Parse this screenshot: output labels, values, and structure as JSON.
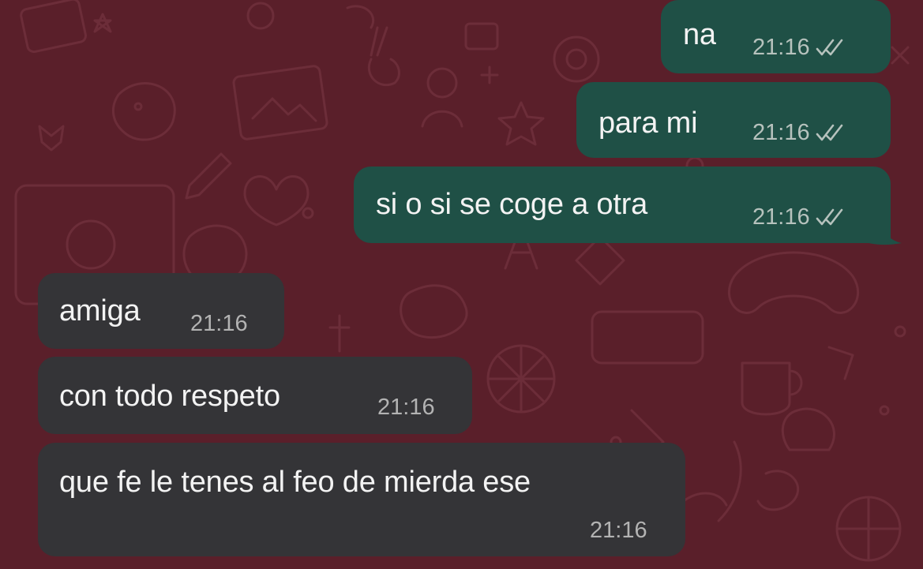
{
  "colors": {
    "background": "#5a1f2a",
    "outgoing_bubble": "#1f5046",
    "incoming_bubble": "#343437",
    "message_text": "#f3f3f3",
    "timestamp": "#b6c2bd"
  },
  "messages": [
    {
      "direction": "outgoing",
      "text": "na",
      "time": "21:16",
      "status_icon": "double-check-icon"
    },
    {
      "direction": "outgoing",
      "text": "para mi",
      "time": "21:16",
      "status_icon": "double-check-icon"
    },
    {
      "direction": "outgoing",
      "text": "si o si se coge a otra",
      "time": "21:16",
      "status_icon": "double-check-icon"
    },
    {
      "direction": "incoming",
      "text": "amiga",
      "time": "21:16"
    },
    {
      "direction": "incoming",
      "text": "con todo respeto",
      "time": "21:16"
    },
    {
      "direction": "incoming",
      "text": "que fe le tenes al feo de mierda ese",
      "time": "21:16"
    }
  ]
}
